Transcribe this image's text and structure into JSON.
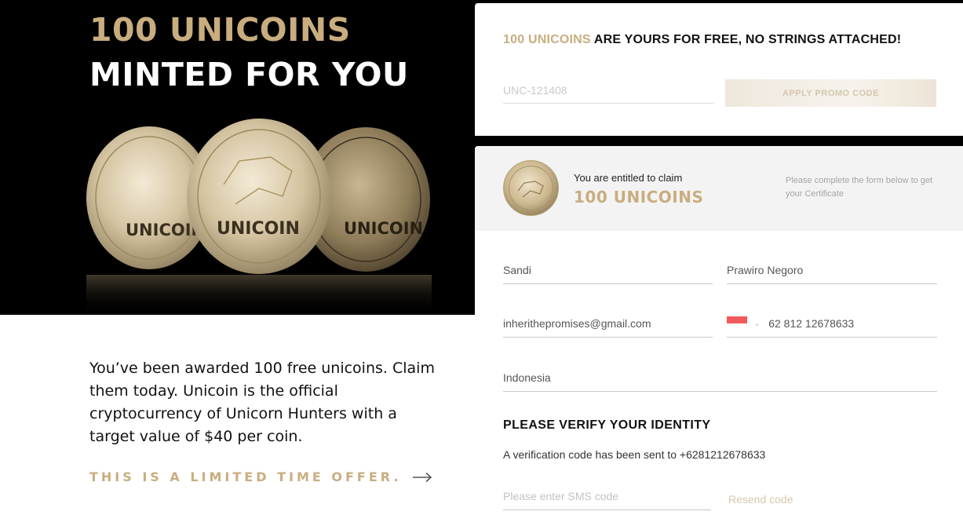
{
  "hero": {
    "title_line1": "100 UNICOINS",
    "title_line2": "MINTED FOR YOU",
    "coin_label": "UNICOIN"
  },
  "left": {
    "description": "You’ve been awarded 100 free unicoins. Claim them today. Unicoin is the official cryptocurrency of Unicorn Hunters with a target value of $40 per coin.",
    "limited_offer": "THIS IS A LIMITED TIME OFFER."
  },
  "promo": {
    "heading_gold": "100 UNICOINS",
    "heading_rest": " ARE YOURS FOR FREE, NO STRINGS ATTACHED!",
    "code_placeholder": "UNC-121408",
    "apply_button": "APPLY PROMO CODE"
  },
  "claim": {
    "line1": "You are entitled to claim",
    "line2": "100 UNICOINS",
    "note": "Please complete the form below to get your Certificate"
  },
  "form": {
    "first_name": "Sandi",
    "last_name": "Prawiro Negoro",
    "email": "inherithepromises@gmail.com",
    "phone": "62 812 12678633",
    "country": "Indonesia"
  },
  "verify": {
    "title": "PLEASE VERIFY YOUR IDENTITY",
    "text": "A verification code has been sent to +6281212678633",
    "sms_placeholder": "Please enter SMS code",
    "resend": "Resend code"
  },
  "colors": {
    "gold": "#c9ad7f",
    "black": "#000000",
    "flag_red": "#f05a5a"
  }
}
